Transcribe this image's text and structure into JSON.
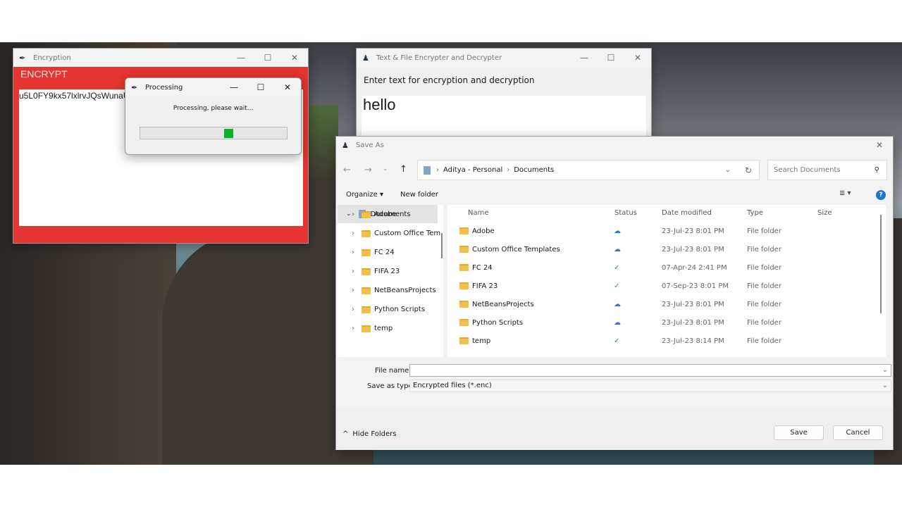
{
  "encryption_window": {
    "title": "Encryption",
    "header": "ENCRYPT",
    "output_text": "u5L0FY9kx57lxlrvJQsWunaUle",
    "bg_color": "#e63530"
  },
  "processing_dialog": {
    "title": "Processing",
    "message": "Processing, please wait...",
    "progress_color": "#0db02b"
  },
  "encrypter_window": {
    "title": "Text & File Encrypter and Decrypter",
    "prompt": "Enter text for encryption and decryption",
    "input_value": "hello"
  },
  "save_as": {
    "title": "Save As",
    "breadcrumb": [
      "Aditya - Personal",
      "Documents"
    ],
    "search_placeholder": "Search Documents",
    "organize": "Organize ▾",
    "new_folder": "New folder",
    "sidebar": [
      {
        "label": "Documents",
        "selected": true
      },
      {
        "label": "Adobe"
      },
      {
        "label": "Custom Office Tem"
      },
      {
        "label": "FC 24"
      },
      {
        "label": "FIFA 23"
      },
      {
        "label": "NetBeansProjects"
      },
      {
        "label": "Python Scripts"
      },
      {
        "label": "temp"
      }
    ],
    "columns": {
      "name": "Name",
      "status": "Status",
      "date": "Date modified",
      "type": "Type",
      "size": "Size"
    },
    "files": [
      {
        "name": "Adobe",
        "status": "cloud",
        "date": "23-Jul-23 8:01 PM",
        "type": "File folder"
      },
      {
        "name": "Custom Office Templates",
        "status": "cloud",
        "date": "23-Jul-23 8:01 PM",
        "type": "File folder"
      },
      {
        "name": "FC 24",
        "status": "synced",
        "date": "07-Apr-24 2:41 PM",
        "type": "File folder"
      },
      {
        "name": "FIFA 23",
        "status": "synced",
        "date": "07-Sep-23 8:01 PM",
        "type": "File folder"
      },
      {
        "name": "NetBeansProjects",
        "status": "cloud",
        "date": "23-Jul-23 8:01 PM",
        "type": "File folder"
      },
      {
        "name": "Python Scripts",
        "status": "cloud",
        "date": "23-Jul-23 8:01 PM",
        "type": "File folder"
      },
      {
        "name": "temp",
        "status": "synced",
        "date": "23-Jul-23 8:14 PM",
        "type": "File folder"
      }
    ],
    "file_name_label": "File name:",
    "file_name_value": "",
    "save_type_label": "Save as type:",
    "save_type_value": "Encrypted files (*.enc)",
    "hide_folders": "Hide Folders",
    "save": "Save",
    "cancel": "Cancel"
  }
}
